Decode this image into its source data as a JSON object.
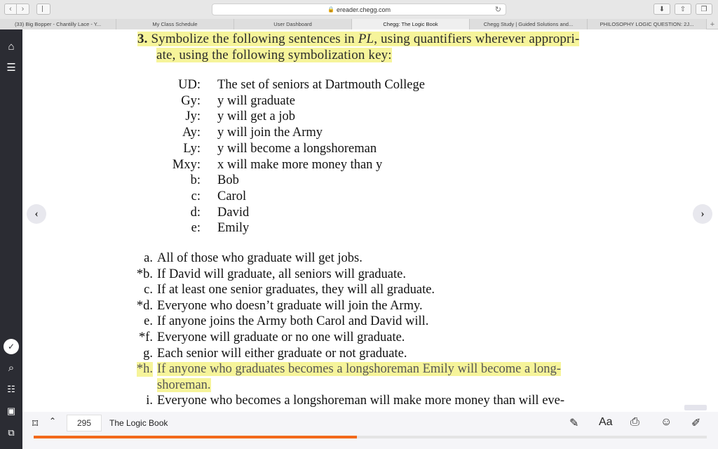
{
  "browser": {
    "url": "ereader.chegg.com",
    "tabs": [
      {
        "label": "(33) Big Bopper - Chantilly Lace - Y..."
      },
      {
        "label": "My Class Schedule"
      },
      {
        "label": "User Dashboard"
      },
      {
        "label": "Chegg: The Logic Book",
        "active": true
      },
      {
        "label": "Chegg Study | Guided Solutions and..."
      },
      {
        "label": "PHILOSOPHY LOGIC QUESTION: 2J..."
      }
    ]
  },
  "question": {
    "line1_num": "3.",
    "line1_a": "Symbolize the following sentences in ",
    "line1_pl": "PL",
    "line1_b": ", using quantifiers wherever appropri-",
    "line2": "ate, using the following symbolization key:"
  },
  "key": [
    {
      "k": "UD:",
      "v": "The set of seniors at Dartmouth College"
    },
    {
      "k": "Gy:",
      "v": "y will graduate"
    },
    {
      "k": "Jy:",
      "v": "y will get a job"
    },
    {
      "k": "Ay:",
      "v": "y will join the Army"
    },
    {
      "k": "Ly:",
      "v": "y will become a longshoreman"
    },
    {
      "k": "Mxy:",
      "v": "x will make more money than y"
    },
    {
      "k": "b:",
      "v": "Bob"
    },
    {
      "k": "c:",
      "v": "Carol"
    },
    {
      "k": "d:",
      "v": "David"
    },
    {
      "k": "e:",
      "v": "Emily"
    }
  ],
  "items": [
    {
      "lbl": "a.",
      "text": "All of those who graduate will get jobs."
    },
    {
      "lbl": "*b.",
      "text": "If David will graduate, all seniors will graduate."
    },
    {
      "lbl": "c.",
      "text": "If at least one senior graduates, they will all graduate."
    },
    {
      "lbl": "*d.",
      "text": "Everyone who doesn’t graduate will join the Army."
    },
    {
      "lbl": "e.",
      "text": "If anyone joins the Army both Carol and David will."
    },
    {
      "lbl": "*f.",
      "text": "Everyone will graduate or no one will graduate."
    },
    {
      "lbl": "g.",
      "text": "Each senior will either graduate or not graduate."
    },
    {
      "lbl": "*h.",
      "text": "If anyone who graduates becomes a longshoreman Emily will become a long-"
    },
    {
      "lbl": "",
      "text": "shoreman."
    },
    {
      "lbl": "i.",
      "text": "Everyone who becomes a longshoreman will make more money than will eve-"
    }
  ],
  "footer": {
    "page": "295",
    "book_title": "The Logic Book",
    "progress": 0.48,
    "font_label": "Aa"
  },
  "colors": {
    "highlight": "#f6f49a",
    "progress": "#f26a1b",
    "sidebar": "#2b2c33"
  }
}
